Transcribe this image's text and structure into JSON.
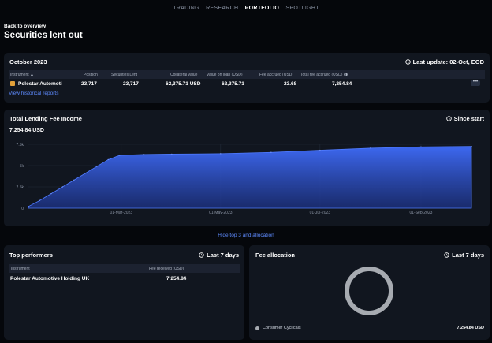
{
  "nav": {
    "items": [
      "TRADING",
      "RESEARCH",
      "PORTFOLIO",
      "SPOTLIGHT"
    ],
    "active": "PORTFOLIO"
  },
  "header": {
    "back_label": "Back to overview",
    "title": "Securities lent out"
  },
  "holdings": {
    "period": "October 2023",
    "last_update": "Last update: 02-Oct, EOD",
    "columns": [
      "Instrument",
      "Position",
      "Securities Lent",
      "Collateral value",
      "Value on loan (USD)",
      "Fee accrued (USD)",
      "Total fee accrued (USD)"
    ],
    "rows": [
      {
        "instrument": "Polestar Automoti",
        "position": "23,717",
        "securities_lent": "23,717",
        "collateral_value": "62,375.71 USD",
        "value_on_loan": "62,375.71",
        "fee_accrued": "23.68",
        "total_fee_accrued": "7,254.84"
      }
    ],
    "more_label": "•••",
    "historical_link": "View historical reports"
  },
  "lending": {
    "title": "Total Lending Fee Income",
    "range_label": "Since start",
    "total": "7,254.84 USD"
  },
  "chart_data": {
    "type": "area",
    "title": "Total Lending Fee Income",
    "xlabel": "",
    "ylabel": "",
    "ylim": [
      0,
      7500
    ],
    "yticks": [
      0,
      2500,
      5000,
      7500
    ],
    "ytick_labels": [
      "0",
      "2.5k",
      "5k",
      "7.5k"
    ],
    "xtick_labels": [
      "01-Mar-2023",
      "01-May-2023",
      "01-Jul-2023",
      "01-Sep-2023"
    ],
    "xtick_dates": [
      "2023-03-01",
      "2023-05-01",
      "2023-07-01",
      "2023-09-01"
    ],
    "x": [
      "2023-01-03",
      "2023-01-10",
      "2023-01-17",
      "2023-01-24",
      "2023-01-31",
      "2023-02-07",
      "2023-02-14",
      "2023-02-21",
      "2023-02-28",
      "2023-03-15",
      "2023-04-01",
      "2023-05-01",
      "2023-06-01",
      "2023-07-01",
      "2023-08-01",
      "2023-09-01",
      "2023-10-02"
    ],
    "values": [
      200,
      900,
      1700,
      2500,
      3300,
      4100,
      4900,
      5700,
      6200,
      6300,
      6350,
      6400,
      6550,
      6800,
      7050,
      7200,
      7254.84
    ],
    "series_color": "#3d68f0",
    "grid": true
  },
  "toggle_link": "Hide top 3 and allocation",
  "top_performers": {
    "title": "Top performers",
    "range_label": "Last 7 days",
    "columns": [
      "Instrument",
      "Fee received (USD)"
    ],
    "rows": [
      {
        "instrument": "Polestar Automotive Holding UK",
        "fee": "7,254.84"
      }
    ]
  },
  "fee_allocation": {
    "title": "Fee allocation",
    "range_label": "Last 7 days",
    "segments": [
      {
        "label": "Consumer Cyclicals",
        "value": "7,254.84 USD",
        "color": "#a7abb1"
      }
    ]
  }
}
